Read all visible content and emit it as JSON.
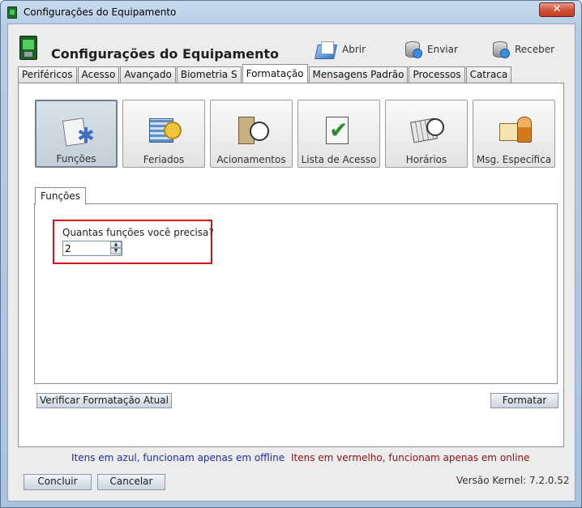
{
  "window": {
    "title": "Configurações do Equipamento",
    "close_label": "✕"
  },
  "header": {
    "title": "Configurações do Equipamento",
    "abrir_label": "Abrir",
    "enviar_label": "Enviar",
    "receber_label": "Receber"
  },
  "tabs": [
    "Periféricos",
    "Acesso",
    "Avançado",
    "Biometria S",
    "Formatação",
    "Mensagens Padrão",
    "Processos",
    "Catraca"
  ],
  "active_tab": "Formatação",
  "icon_buttons": [
    {
      "label": "Funções",
      "icon": "functions-icon",
      "selected": true
    },
    {
      "label": "Feriados",
      "icon": "holidays-icon",
      "selected": false
    },
    {
      "label": "Acionamentos",
      "icon": "triggers-icon",
      "selected": false
    },
    {
      "label": "Lista de Acesso",
      "icon": "access-list-icon",
      "selected": false
    },
    {
      "label": "Horários",
      "icon": "schedules-icon",
      "selected": false
    },
    {
      "label": "Msg. Específica",
      "icon": "specific-message-icon",
      "selected": false
    }
  ],
  "inner_tab": {
    "label": "Funções"
  },
  "question": {
    "label": "Quantas funções você precisa?",
    "value": "2"
  },
  "buttons": {
    "verify_label": "Verificar Formatação Atual",
    "format_label": "Formatar",
    "ok_label": "Concluir",
    "cancel_label": "Cancelar"
  },
  "notes": {
    "offline": "Itens em azul, funcionam apenas em offline",
    "online": "Itens em vermelho, funcionam apenas em online"
  },
  "version": "Versão Kernel: 7.2.0.52",
  "colors": {
    "note_blue": "#1e2f9a",
    "note_red": "#8c1010",
    "highlight": "#d6111a"
  }
}
